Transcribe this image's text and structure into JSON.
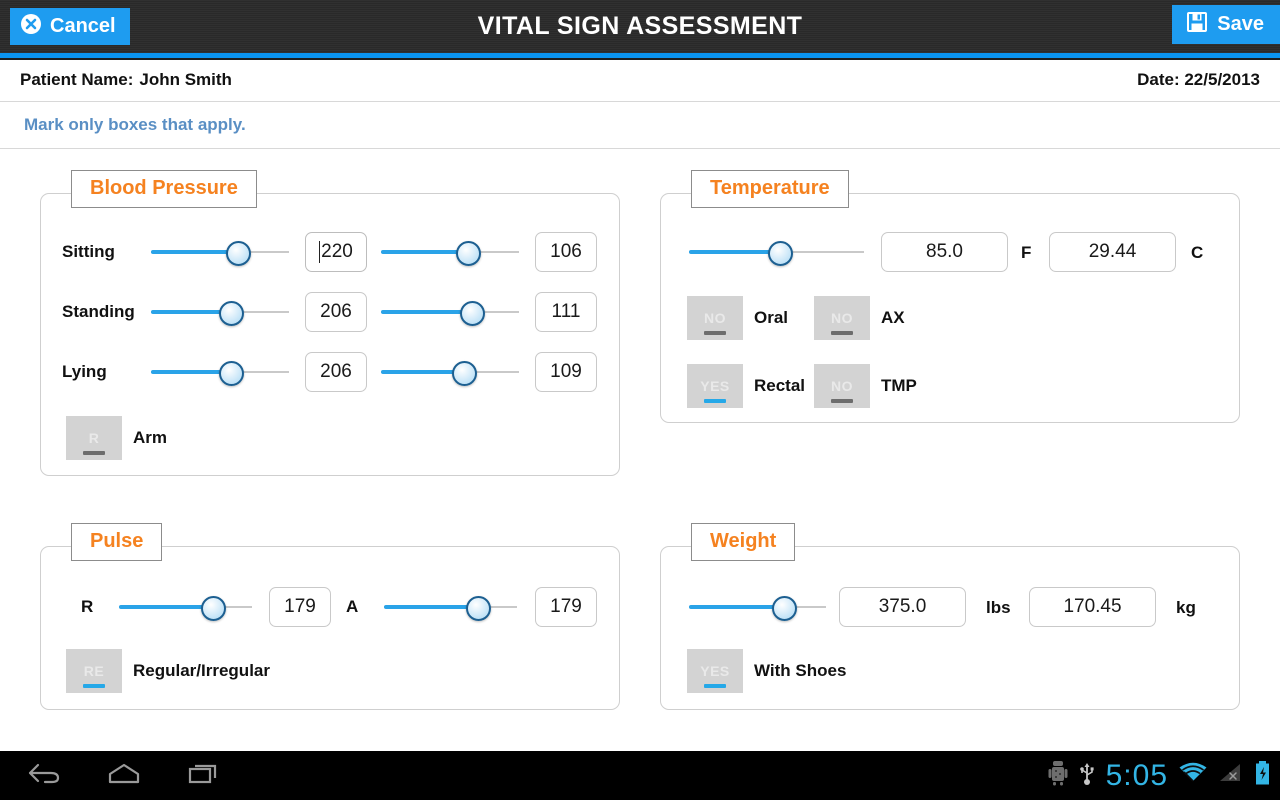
{
  "titlebar": {
    "title": "VITAL SIGN ASSESSMENT",
    "cancel_label": "Cancel",
    "cancel_icon": "circle-x-icon",
    "save_label": "Save",
    "save_icon": "floppy-disk-icon",
    "accent_color": "#0a94f0",
    "bg_color": "#2b2b2b"
  },
  "patient": {
    "name_label": "Patient Name:",
    "name_value": "John Smith",
    "date_label": "Date:",
    "date_value": "22/5/2013",
    "date_text": "Date: 22/5/2013"
  },
  "hint": {
    "text": "Mark only boxes that apply.",
    "color": "#5a8fc4"
  },
  "panels": {
    "blood_pressure": {
      "title": "Blood Pressure",
      "title_color": "#f58220",
      "rows": [
        {
          "label": "Sitting",
          "systolic": {
            "value": "220",
            "slider_percent": 63,
            "focused": true
          },
          "diastolic": {
            "value": "106",
            "slider_percent": 63,
            "focused": false
          }
        },
        {
          "label": "Standing",
          "systolic": {
            "value": "206",
            "slider_percent": 58,
            "focused": false
          },
          "diastolic": {
            "value": "111",
            "slider_percent": 66,
            "focused": false
          }
        },
        {
          "label": "Lying",
          "systolic": {
            "value": "206",
            "slider_percent": 58,
            "focused": false
          },
          "diastolic": {
            "value": "109",
            "slider_percent": 60,
            "focused": false
          }
        }
      ],
      "toggles": [
        {
          "value": "R",
          "label": "Arm",
          "on": false
        }
      ]
    },
    "temperature": {
      "title": "Temperature",
      "title_color": "#f58220",
      "slider_percent": 52,
      "fields": [
        {
          "value": "85.0",
          "unit": "F"
        },
        {
          "value": "29.44",
          "unit": "C"
        }
      ],
      "toggles": [
        {
          "value": "NO",
          "label": "Oral",
          "on": false
        },
        {
          "value": "NO",
          "label": "AX",
          "on": false
        },
        {
          "value": "YES",
          "label": "Rectal",
          "on": true
        },
        {
          "value": "NO",
          "label": "TMP",
          "on": false
        }
      ]
    },
    "pulse": {
      "title": "Pulse",
      "title_color": "#f58220",
      "rows": [
        {
          "label": "R",
          "value": "179",
          "slider_percent": 71
        },
        {
          "label": "A",
          "value": "179",
          "slider_percent": 71
        }
      ],
      "toggles": [
        {
          "value": "RE",
          "label": "Regular/Irregular",
          "on": true
        }
      ]
    },
    "weight": {
      "title": "Weight",
      "title_color": "#f58220",
      "slider_percent": 69,
      "fields": [
        {
          "value": "375.0",
          "unit": "lbs"
        },
        {
          "value": "170.45",
          "unit": "kg"
        }
      ],
      "toggles": [
        {
          "value": "YES",
          "label": "With Shoes",
          "on": true
        }
      ]
    }
  },
  "navbar": {
    "back_icon": "back-arrow-icon",
    "home_icon": "home-icon",
    "recents_icon": "recent-apps-icon",
    "android_icon": "android-debug-icon",
    "usb_icon": "usb-icon",
    "clock": "5:05",
    "wifi_icon": "wifi-icon",
    "signal_icon": "signal-off-icon",
    "battery_icon": "battery-charging-icon",
    "clock_color": "#33b5e5"
  }
}
